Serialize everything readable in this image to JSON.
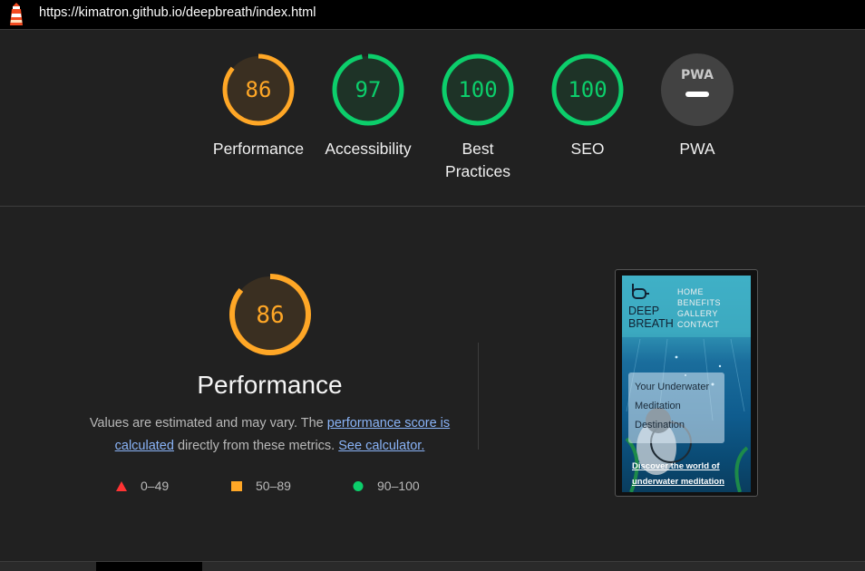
{
  "address_bar": {
    "url": "https://kimatron.github.io/deepbreath/index.html"
  },
  "colors": {
    "orange": "#ffa726",
    "green": "#0cce6b",
    "red": "#f33",
    "gray_bg": "#424242",
    "orange_bg": "#3a2f21",
    "green_bg": "#1e3327"
  },
  "gauges": [
    {
      "value": "86",
      "score": 0.86,
      "label": "Performance",
      "status": "average"
    },
    {
      "value": "97",
      "score": 0.97,
      "label": "Accessibility",
      "status": "pass"
    },
    {
      "value": "100",
      "score": 1.0,
      "label": "Best Practices",
      "status": "pass"
    },
    {
      "value": "100",
      "score": 1.0,
      "label": "SEO",
      "status": "pass"
    },
    {
      "value": "",
      "score": 0,
      "label": "PWA",
      "status": "na",
      "badge": "PWA"
    }
  ],
  "performance": {
    "score": "86",
    "score_fraction": 0.86,
    "title": "Performance",
    "desc_before": "Values are estimated and may vary. The ",
    "link1": "performance score is calculated",
    "desc_middle": " directly from these metrics. ",
    "link2": "See calculator."
  },
  "legend": [
    {
      "shape": "triangle",
      "range": "0–49"
    },
    {
      "shape": "square",
      "range": "50–89"
    },
    {
      "shape": "circle",
      "range": "90–100"
    }
  ],
  "screenshot": {
    "nav": [
      "HOME",
      "BENEFITS",
      "GALLERY",
      "CONTACT"
    ],
    "brand_line1": "DEEP",
    "brand_line2": "BREATH",
    "card_line1": "Your Underwater",
    "card_line2": "Meditation",
    "card_line3": "Destination",
    "link": "Discover the world of underwater meditation"
  }
}
